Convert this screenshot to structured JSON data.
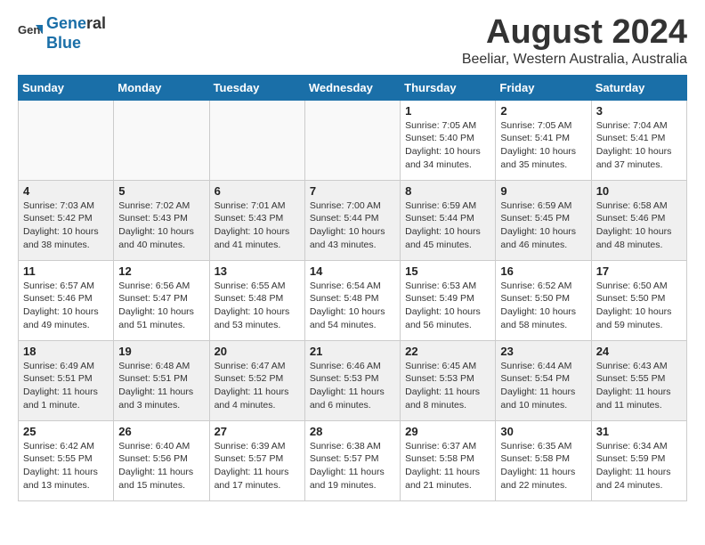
{
  "header": {
    "logo_line1": "General",
    "logo_line2": "Blue",
    "main_title": "August 2024",
    "subtitle": "Beeliar, Western Australia, Australia"
  },
  "days_of_week": [
    "Sunday",
    "Monday",
    "Tuesday",
    "Wednesday",
    "Thursday",
    "Friday",
    "Saturday"
  ],
  "weeks": [
    [
      {
        "num": "",
        "info": ""
      },
      {
        "num": "",
        "info": ""
      },
      {
        "num": "",
        "info": ""
      },
      {
        "num": "",
        "info": ""
      },
      {
        "num": "1",
        "info": "Sunrise: 7:05 AM\nSunset: 5:40 PM\nDaylight: 10 hours\nand 34 minutes."
      },
      {
        "num": "2",
        "info": "Sunrise: 7:05 AM\nSunset: 5:41 PM\nDaylight: 10 hours\nand 35 minutes."
      },
      {
        "num": "3",
        "info": "Sunrise: 7:04 AM\nSunset: 5:41 PM\nDaylight: 10 hours\nand 37 minutes."
      }
    ],
    [
      {
        "num": "4",
        "info": "Sunrise: 7:03 AM\nSunset: 5:42 PM\nDaylight: 10 hours\nand 38 minutes."
      },
      {
        "num": "5",
        "info": "Sunrise: 7:02 AM\nSunset: 5:43 PM\nDaylight: 10 hours\nand 40 minutes."
      },
      {
        "num": "6",
        "info": "Sunrise: 7:01 AM\nSunset: 5:43 PM\nDaylight: 10 hours\nand 41 minutes."
      },
      {
        "num": "7",
        "info": "Sunrise: 7:00 AM\nSunset: 5:44 PM\nDaylight: 10 hours\nand 43 minutes."
      },
      {
        "num": "8",
        "info": "Sunrise: 6:59 AM\nSunset: 5:44 PM\nDaylight: 10 hours\nand 45 minutes."
      },
      {
        "num": "9",
        "info": "Sunrise: 6:59 AM\nSunset: 5:45 PM\nDaylight: 10 hours\nand 46 minutes."
      },
      {
        "num": "10",
        "info": "Sunrise: 6:58 AM\nSunset: 5:46 PM\nDaylight: 10 hours\nand 48 minutes."
      }
    ],
    [
      {
        "num": "11",
        "info": "Sunrise: 6:57 AM\nSunset: 5:46 PM\nDaylight: 10 hours\nand 49 minutes."
      },
      {
        "num": "12",
        "info": "Sunrise: 6:56 AM\nSunset: 5:47 PM\nDaylight: 10 hours\nand 51 minutes."
      },
      {
        "num": "13",
        "info": "Sunrise: 6:55 AM\nSunset: 5:48 PM\nDaylight: 10 hours\nand 53 minutes."
      },
      {
        "num": "14",
        "info": "Sunrise: 6:54 AM\nSunset: 5:48 PM\nDaylight: 10 hours\nand 54 minutes."
      },
      {
        "num": "15",
        "info": "Sunrise: 6:53 AM\nSunset: 5:49 PM\nDaylight: 10 hours\nand 56 minutes."
      },
      {
        "num": "16",
        "info": "Sunrise: 6:52 AM\nSunset: 5:50 PM\nDaylight: 10 hours\nand 58 minutes."
      },
      {
        "num": "17",
        "info": "Sunrise: 6:50 AM\nSunset: 5:50 PM\nDaylight: 10 hours\nand 59 minutes."
      }
    ],
    [
      {
        "num": "18",
        "info": "Sunrise: 6:49 AM\nSunset: 5:51 PM\nDaylight: 11 hours\nand 1 minute."
      },
      {
        "num": "19",
        "info": "Sunrise: 6:48 AM\nSunset: 5:51 PM\nDaylight: 11 hours\nand 3 minutes."
      },
      {
        "num": "20",
        "info": "Sunrise: 6:47 AM\nSunset: 5:52 PM\nDaylight: 11 hours\nand 4 minutes."
      },
      {
        "num": "21",
        "info": "Sunrise: 6:46 AM\nSunset: 5:53 PM\nDaylight: 11 hours\nand 6 minutes."
      },
      {
        "num": "22",
        "info": "Sunrise: 6:45 AM\nSunset: 5:53 PM\nDaylight: 11 hours\nand 8 minutes."
      },
      {
        "num": "23",
        "info": "Sunrise: 6:44 AM\nSunset: 5:54 PM\nDaylight: 11 hours\nand 10 minutes."
      },
      {
        "num": "24",
        "info": "Sunrise: 6:43 AM\nSunset: 5:55 PM\nDaylight: 11 hours\nand 11 minutes."
      }
    ],
    [
      {
        "num": "25",
        "info": "Sunrise: 6:42 AM\nSunset: 5:55 PM\nDaylight: 11 hours\nand 13 minutes."
      },
      {
        "num": "26",
        "info": "Sunrise: 6:40 AM\nSunset: 5:56 PM\nDaylight: 11 hours\nand 15 minutes."
      },
      {
        "num": "27",
        "info": "Sunrise: 6:39 AM\nSunset: 5:57 PM\nDaylight: 11 hours\nand 17 minutes."
      },
      {
        "num": "28",
        "info": "Sunrise: 6:38 AM\nSunset: 5:57 PM\nDaylight: 11 hours\nand 19 minutes."
      },
      {
        "num": "29",
        "info": "Sunrise: 6:37 AM\nSunset: 5:58 PM\nDaylight: 11 hours\nand 21 minutes."
      },
      {
        "num": "30",
        "info": "Sunrise: 6:35 AM\nSunset: 5:58 PM\nDaylight: 11 hours\nand 22 minutes."
      },
      {
        "num": "31",
        "info": "Sunrise: 6:34 AM\nSunset: 5:59 PM\nDaylight: 11 hours\nand 24 minutes."
      }
    ]
  ]
}
